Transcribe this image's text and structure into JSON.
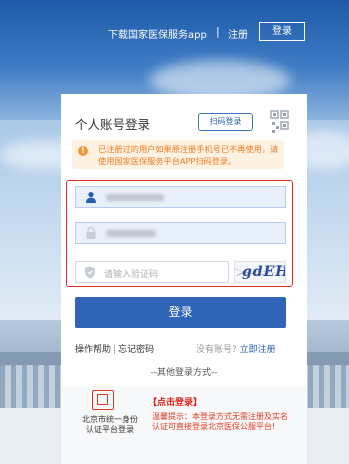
{
  "header": {
    "app_link": "下载国家医保服务app",
    "separator": "|",
    "register": "注册",
    "login_button": "登录"
  },
  "card": {
    "title": "个人账号登录",
    "qr_tab": "扫码登录",
    "notice": "已注册过的用户如果原注册手机号已不再使用，请使用国家医保服务平台APP扫码登录。",
    "captcha_placeholder": "请输入验证码",
    "captcha_text": "gdEH",
    "login_button": "登录",
    "help": "操作帮助",
    "help_sep": "|",
    "forgot": "忘记密码",
    "no_account": "没有账号?",
    "register_now": "立即注册",
    "other_methods": "--其他登录方式--"
  },
  "bottom": {
    "bj_platform": "北京市统一身份认证平台登录",
    "click_login": "【点击登录】",
    "tips": "温馨提示：本登录方式无需注册及实名认证可直接登录北京医保公服平台!"
  },
  "colors": {
    "accent": "#2f64b7",
    "warning": "#ee7d21",
    "error_border": "#e32b24"
  }
}
